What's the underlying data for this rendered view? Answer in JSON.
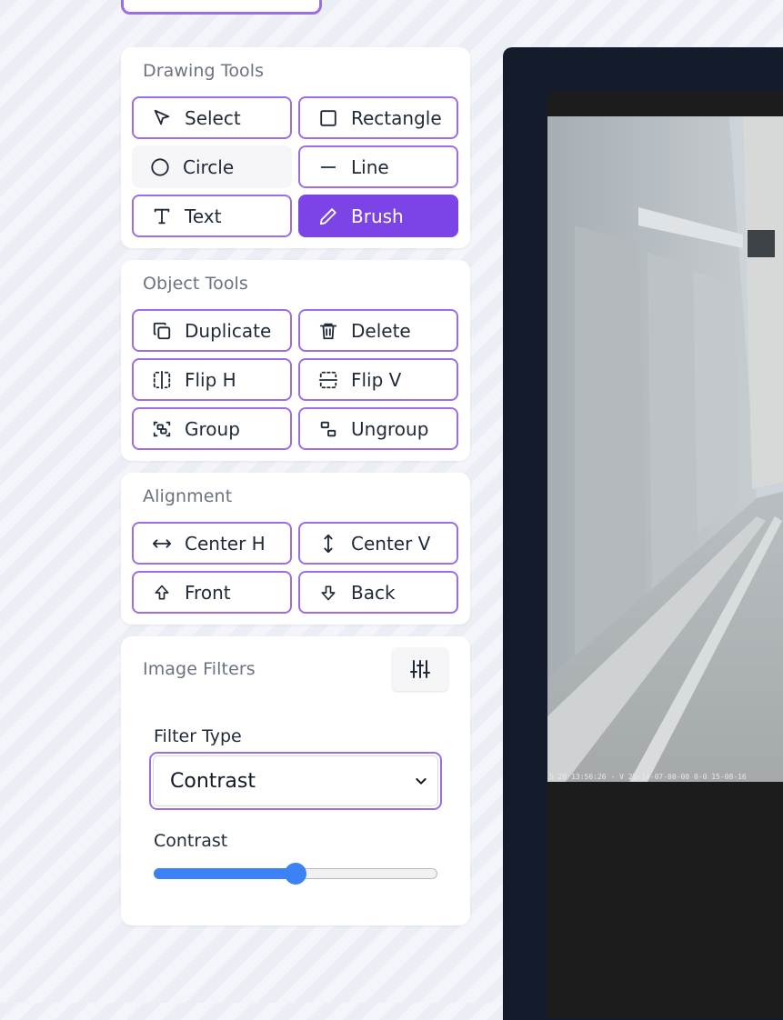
{
  "drawing_tools": {
    "title": "Drawing Tools",
    "select": "Select",
    "rectangle": "Rectangle",
    "circle": "Circle",
    "line": "Line",
    "text": "Text",
    "brush": "Brush",
    "active_tool": "Brush"
  },
  "object_tools": {
    "title": "Object Tools",
    "duplicate": "Duplicate",
    "delete": "Delete",
    "flip_h": "Flip H",
    "flip_v": "Flip V",
    "group": "Group",
    "ungroup": "Ungroup"
  },
  "alignment": {
    "title": "Alignment",
    "center_h": "Center H",
    "center_v": "Center V",
    "front": "Front",
    "back": "Back"
  },
  "image_filters": {
    "title": "Image Filters",
    "filter_type_label": "Filter Type",
    "filter_type_value": "Contrast",
    "slider_label": "Contrast",
    "slider_fraction": 0.5
  },
  "canvas": {
    "timestamp": "5 20 13:56:26 - V 25-14-07-00-00 0-0 15-08-16"
  },
  "colors": {
    "accent": "#7c44e6",
    "border": "#9b6ee8",
    "slider": "#3b82f6",
    "canvas_bg": "#141b2b"
  }
}
